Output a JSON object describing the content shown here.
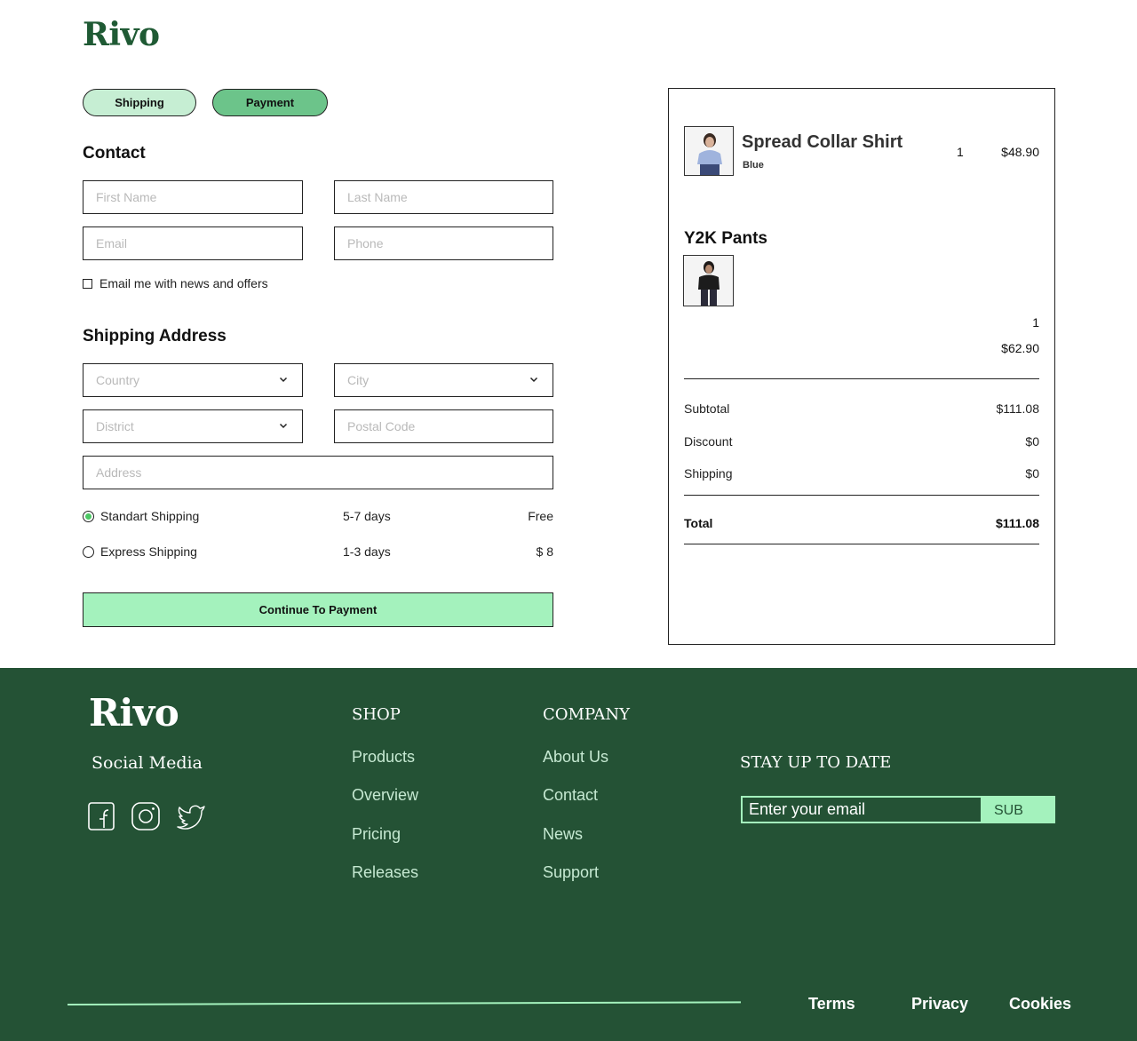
{
  "brand": {
    "logo": "Rivo"
  },
  "steps": {
    "shipping": "Shipping",
    "payment": "Payment"
  },
  "contact": {
    "title": "Contact",
    "first_name_placeholder": "First Name",
    "last_name_placeholder": "Last Name",
    "email_placeholder": "Email",
    "phone_placeholder": "Phone",
    "newsletter_label": "Email me with news and offers"
  },
  "shipping_address": {
    "title": "Shipping Address",
    "country": "Country",
    "city": "City",
    "district": "District",
    "postal_placeholder": "Postal Code",
    "address_placeholder": "Address"
  },
  "shipping_options": [
    {
      "name": "Standart Shipping",
      "days": "5-7 days",
      "price": "Free",
      "selected": true
    },
    {
      "name": "Express Shipping",
      "days": "1-3 days",
      "price": "$ 8",
      "selected": false
    }
  ],
  "continue_label": "Continue To Payment",
  "order": {
    "items": [
      {
        "name": "Spread Collar Shirt",
        "variant": "Blue",
        "qty": "1",
        "price": "$48.90"
      },
      {
        "name": "Y2K Pants",
        "qty": "1",
        "price": "$62.90"
      }
    ],
    "subtotal_label": "Subtotal",
    "subtotal": "$111.08",
    "discount_label": "Discount",
    "discount": "$0",
    "shipping_label": "Shipping",
    "shipping": "$0",
    "total_label": "Total",
    "total": "$111.08"
  },
  "footer": {
    "logo": "Rivo",
    "social_title": "Social Media",
    "social_icons": [
      "facebook-icon",
      "instagram-icon",
      "twitter-icon"
    ],
    "shop_title": "SHOP",
    "shop_links": [
      "Products",
      "Overview",
      "Pricing",
      "Releases"
    ],
    "company_title": "COMPANY",
    "company_links": [
      "About Us",
      "Contact",
      "News",
      "Support"
    ],
    "newsletter_title": "STAY UP TO DATE",
    "newsletter_placeholder": "Enter your email",
    "newsletter_button": "SUB",
    "bottom_links": [
      "Terms",
      "Privacy",
      "Cookies"
    ]
  },
  "colors": {
    "brand_dark": "#1f5a34",
    "footer_bg": "#245235",
    "accent": "#a4f2bd",
    "pill_light": "#c6eed3",
    "pill_active": "#6cc48a",
    "radio_on": "#4cc864"
  }
}
